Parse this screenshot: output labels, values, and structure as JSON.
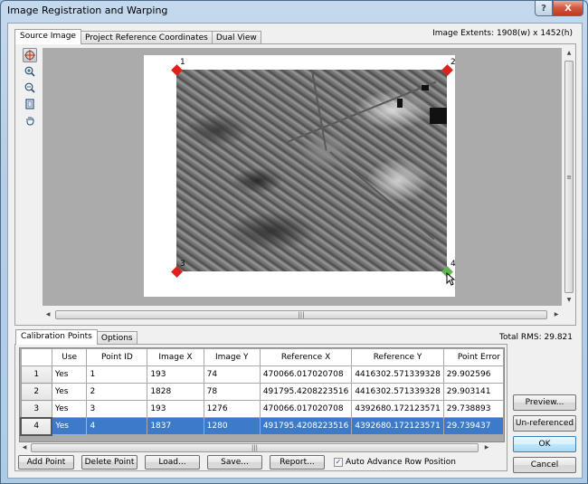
{
  "window": {
    "title": "Image Registration and Warping",
    "help_label": "?",
    "close_label": "X"
  },
  "top_tabs": [
    {
      "label": "Source Image",
      "active": true
    },
    {
      "label": "Project Reference Coordinates",
      "active": false
    },
    {
      "label": "Dual View",
      "active": false
    }
  ],
  "image_extents": "Image Extents: 1908(w) x 1452(h)",
  "tools": [
    {
      "name": "select-point-tool",
      "glyph": "⊕",
      "active": true
    },
    {
      "name": "zoom-in-tool",
      "glyph": "🔍︎+",
      "active": false
    },
    {
      "name": "zoom-out-tool",
      "glyph": "🔍︎-",
      "active": false
    },
    {
      "name": "fit-to-window-tool",
      "glyph": "▣",
      "active": false
    },
    {
      "name": "pan-tool",
      "glyph": "✋",
      "active": false
    }
  ],
  "markers": [
    {
      "id": "1",
      "color": "#e0201a",
      "corner": "top-left"
    },
    {
      "id": "2",
      "color": "#e0201a",
      "corner": "top-right"
    },
    {
      "id": "3",
      "color": "#e0201a",
      "corner": "bottom-left"
    },
    {
      "id": "4",
      "color": "#5cb84a",
      "corner": "bottom-right"
    }
  ],
  "scroll": {
    "grip": "|||",
    "grip_v": "≡",
    "up": "▲",
    "down": "▼",
    "left": "◀",
    "right": "▶"
  },
  "bottom_tabs": [
    {
      "label": "Calibration Points",
      "active": true
    },
    {
      "label": "Options",
      "active": false
    }
  ],
  "total_rms": "Total RMS: 29.821",
  "table": {
    "columns": [
      "Use",
      "Point ID",
      "Image X",
      "Image Y",
      "Reference X",
      "Reference Y",
      "Point Error"
    ],
    "rows": [
      {
        "row": "1",
        "cells": [
          "Yes",
          "1",
          "193",
          "74",
          "470066.017020708",
          "4416302.571339328",
          "29.902596"
        ],
        "selected": false
      },
      {
        "row": "2",
        "cells": [
          "Yes",
          "2",
          "1828",
          "78",
          "491795.4208223516",
          "4416302.571339328",
          "29.903141"
        ],
        "selected": false
      },
      {
        "row": "3",
        "cells": [
          "Yes",
          "3",
          "193",
          "1276",
          "470066.017020708",
          "4392680.172123571",
          "29.738893"
        ],
        "selected": false
      },
      {
        "row": "4",
        "cells": [
          "Yes",
          "4",
          "1837",
          "1280",
          "491795.4208223516",
          "4392680.172123571",
          "29.739437"
        ],
        "selected": true
      }
    ]
  },
  "actions": {
    "add_point": "Add Point",
    "delete_point": "Delete Point",
    "load": "Load...",
    "save": "Save...",
    "report": "Report...",
    "auto_advance_label": "Auto Advance Row Position",
    "auto_advance_checked": true,
    "check_glyph": "✓"
  },
  "side_buttons": {
    "preview": "Preview...",
    "unreferenced": "Un-referenced",
    "ok": "OK",
    "cancel": "Cancel"
  }
}
